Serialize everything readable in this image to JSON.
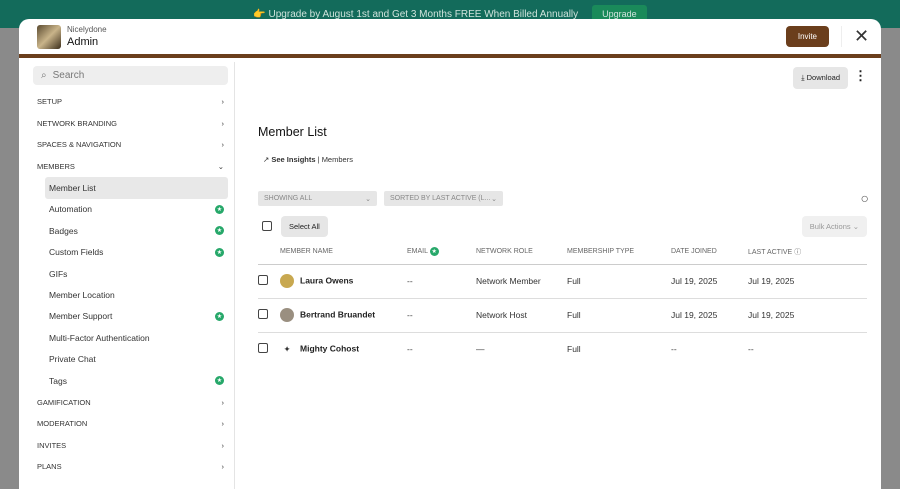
{
  "banner": {
    "text": "👉 Upgrade by August 1st and Get 3 Months FREE When Billed Annually",
    "button": "Upgrade"
  },
  "header": {
    "org": "Nicelydone",
    "title": "Admin",
    "invite": "Invite",
    "close": "✕"
  },
  "sidebar": {
    "search_placeholder": "Search",
    "sections_top": [
      "SETUP",
      "NETWORK BRANDING",
      "SPACES & NAVIGATION"
    ],
    "members_label": "MEMBERS",
    "items": [
      {
        "label": "Member List",
        "star": false
      },
      {
        "label": "Automation",
        "star": true
      },
      {
        "label": "Badges",
        "star": true
      },
      {
        "label": "Custom Fields",
        "star": true
      },
      {
        "label": "GIFs",
        "star": false
      },
      {
        "label": "Member Location",
        "star": false
      },
      {
        "label": "Member Support",
        "star": true
      },
      {
        "label": "Multi-Factor Authentication",
        "star": false
      },
      {
        "label": "Private Chat",
        "star": false
      },
      {
        "label": "Tags",
        "star": true
      }
    ],
    "sections_bottom": [
      "GAMIFICATION",
      "MODERATION",
      "INVITES",
      "PLANS"
    ]
  },
  "main": {
    "download": "Download",
    "title": "Member List",
    "insights": "See Insights",
    "insights_sub": "| Members",
    "filter_showing": "SHOWING ALL",
    "filter_sort": "SORTED BY LAST ACTIVE (L...",
    "select_all": "Select All",
    "bulk": "Bulk Actions",
    "columns": [
      "MEMBER NAME",
      "EMAIL",
      "NETWORK ROLE",
      "MEMBERSHIP TYPE",
      "DATE JOINED",
      "LAST ACTIVE"
    ],
    "rows": [
      {
        "name": "Laura Owens",
        "email": "--",
        "role": "Network Member",
        "type": "Full",
        "joined": "Jul 19, 2025",
        "active": "Jul 19, 2025",
        "avatar": "#c8a850"
      },
      {
        "name": "Bertrand Bruandet",
        "email": "--",
        "role": "Network Host",
        "type": "Full",
        "joined": "Jul 19, 2025",
        "active": "Jul 19, 2025",
        "avatar": "#9a8f80"
      },
      {
        "name": "Mighty Cohost",
        "email": "--",
        "role": "—",
        "type": "Full",
        "joined": "--",
        "active": "--",
        "avatar": "sparkle"
      }
    ]
  }
}
